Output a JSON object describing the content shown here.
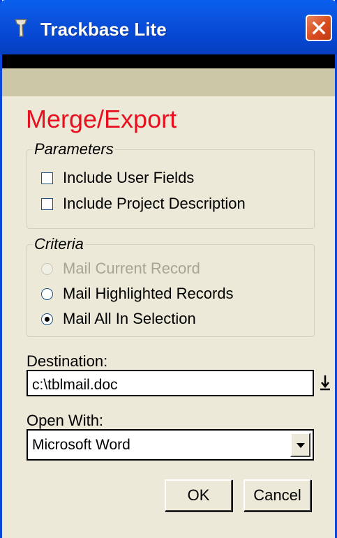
{
  "window": {
    "title": "Trackbase Lite",
    "icons": {
      "app": "trackbase-app-icon",
      "close": "close-icon"
    }
  },
  "heading": "Merge/Export",
  "colors": {
    "titlebar": "#0a5fee",
    "heading": "#e8101f",
    "body": "#ece9d8",
    "band": "#ccc7a6"
  },
  "parameters": {
    "legend": "Parameters",
    "items": [
      {
        "label": "Include User Fields",
        "checked": false
      },
      {
        "label": "Include Project Description",
        "checked": false
      }
    ]
  },
  "criteria": {
    "legend": "Criteria",
    "options": [
      {
        "label": "Mail Current Record",
        "selected": false,
        "enabled": false
      },
      {
        "label": "Mail Highlighted Records",
        "selected": false,
        "enabled": true
      },
      {
        "label": "Mail All In Selection",
        "selected": true,
        "enabled": true
      }
    ]
  },
  "destination": {
    "label": "Destination:",
    "value": "c:\\tblmail.doc"
  },
  "open_with": {
    "label": "Open With:",
    "value": "Microsoft Word"
  },
  "buttons": {
    "ok": "OK",
    "cancel": "Cancel"
  }
}
